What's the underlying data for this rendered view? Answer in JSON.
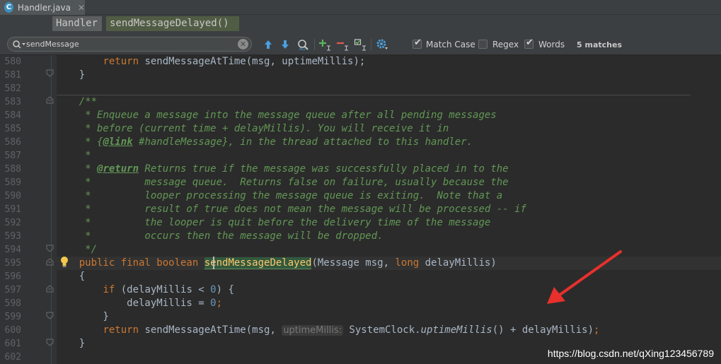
{
  "tab": {
    "icon_letter": "C",
    "file_name": "Handler.java",
    "close_glyph": "✕"
  },
  "breadcrumb": [
    "Handler",
    "sendMessageDelayed()"
  ],
  "search": {
    "value": "sendMessage",
    "clear_glyph": "✕"
  },
  "toolbar": {
    "icons": [
      "arrow-up-icon",
      "arrow-down-icon",
      "find-usages-icon",
      "add-occurrence-icon",
      "remove-occurrence-icon",
      "select-all-occurrences-icon",
      "filter-settings-icon"
    ],
    "options": [
      {
        "label": "Match Case",
        "checked": true
      },
      {
        "label": "Regex",
        "checked": false
      },
      {
        "label": "Words",
        "checked": true
      }
    ],
    "matches": "5 matches"
  },
  "colors": {
    "keyword": "#cc7832",
    "method": "#ffc66d",
    "comment": "#629755",
    "number": "#6897bb",
    "text": "#a9b7c6",
    "arrow": "#e8302c"
  },
  "editor": {
    "first_line": 580,
    "lines": [
      {
        "n": "580",
        "segs": [
          {
            "t": "        "
          },
          {
            "t": "return",
            "c": "k"
          },
          {
            "t": " sendMessageAtTime(msg, uptimeMillis);"
          }
        ]
      },
      {
        "n": "581",
        "segs": [
          {
            "t": "    }"
          }
        ]
      },
      {
        "n": "582",
        "segs": []
      },
      {
        "n": "583",
        "segs": [
          {
            "t": "    /**",
            "c": "d"
          }
        ]
      },
      {
        "n": "584",
        "segs": [
          {
            "t": "     * Enqueue a message into the message queue after all pending messages",
            "c": "d"
          }
        ]
      },
      {
        "n": "585",
        "segs": [
          {
            "t": "     * before (current time + delayMillis). You will receive it in",
            "c": "d"
          }
        ]
      },
      {
        "n": "586",
        "segs": [
          {
            "t": "     * {",
            "c": "d"
          },
          {
            "t": "@link",
            "c": "t"
          },
          {
            "t": " #handleMessage}, in the thread attached to this handler.",
            "c": "d"
          }
        ]
      },
      {
        "n": "587",
        "segs": [
          {
            "t": "     *",
            "c": "d"
          }
        ]
      },
      {
        "n": "588",
        "segs": [
          {
            "t": "     * ",
            "c": "d"
          },
          {
            "t": "@return",
            "c": "t"
          },
          {
            "t": " Returns true if the message was successfully placed in to the",
            "c": "d"
          }
        ]
      },
      {
        "n": "589",
        "segs": [
          {
            "t": "     *         message queue.  Returns false on failure, usually because the",
            "c": "d"
          }
        ]
      },
      {
        "n": "590",
        "segs": [
          {
            "t": "     *         looper processing the message queue is exiting.  Note that a",
            "c": "d"
          }
        ]
      },
      {
        "n": "591",
        "segs": [
          {
            "t": "     *         result of true does not mean the message will be processed -- if",
            "c": "d"
          }
        ]
      },
      {
        "n": "592",
        "segs": [
          {
            "t": "     *         the looper is quit before the delivery time of the message",
            "c": "d"
          }
        ]
      },
      {
        "n": "593",
        "segs": [
          {
            "t": "     *         occurs then the message will be dropped.",
            "c": "d"
          }
        ]
      },
      {
        "n": "594",
        "segs": [
          {
            "t": "     */",
            "c": "d"
          }
        ]
      },
      {
        "n": "595",
        "current": true,
        "segs": [
          {
            "t": "    "
          },
          {
            "t": "public final boolean",
            "c": "k"
          },
          {
            "t": " "
          },
          {
            "t": "sendMessageDelayed",
            "c": "h"
          },
          {
            "t": "(Message msg, "
          },
          {
            "t": "long",
            "c": "k"
          },
          {
            "t": " delayMillis)"
          }
        ]
      },
      {
        "n": "596",
        "segs": [
          {
            "t": "    {"
          }
        ]
      },
      {
        "n": "597",
        "segs": [
          {
            "t": "        "
          },
          {
            "t": "if",
            "c": "k"
          },
          {
            "t": " (delayMillis < "
          },
          {
            "t": "0",
            "c": "n"
          },
          {
            "t": ") {"
          }
        ]
      },
      {
        "n": "598",
        "segs": [
          {
            "t": "            delayMillis = "
          },
          {
            "t": "0",
            "c": "n"
          },
          {
            "t": ";",
            "c": "k"
          }
        ]
      },
      {
        "n": "599",
        "segs": [
          {
            "t": "        }"
          }
        ]
      },
      {
        "n": "600",
        "segs": [
          {
            "t": "        "
          },
          {
            "t": "return",
            "c": "k"
          },
          {
            "t": " sendMessageAtTime(msg, "
          },
          {
            "t": "uptimeMillis:",
            "c": "hint"
          },
          {
            "t": " SystemClock."
          },
          {
            "t": "uptimeMillis",
            "c": "i"
          },
          {
            "t": "() + delayMillis)"
          },
          {
            "t": ";",
            "c": "k"
          }
        ]
      },
      {
        "n": "601",
        "segs": [
          {
            "t": "    }"
          }
        ]
      },
      {
        "n": "602",
        "segs": []
      }
    ]
  },
  "watermark": "https://blog.csdn.net/qXing123456789"
}
